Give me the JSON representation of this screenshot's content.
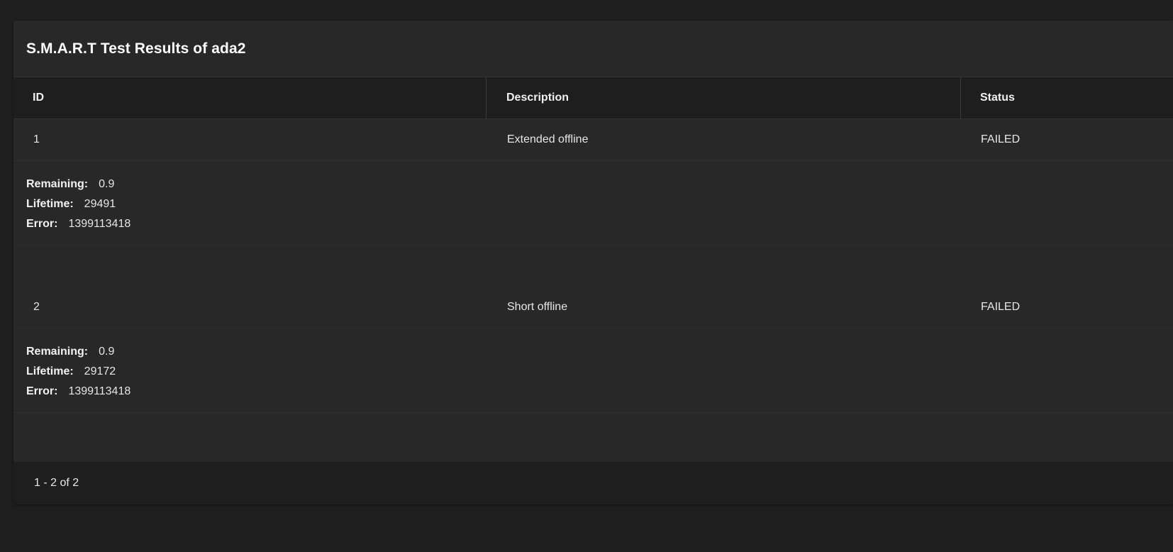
{
  "card": {
    "title": "S.M.A.R.T Test Results of ada2"
  },
  "table": {
    "columns": [
      "ID",
      "Description",
      "Status"
    ],
    "rows": [
      {
        "id": "1",
        "description": "Extended offline",
        "status": "FAILED",
        "details": {
          "remaining_label": "Remaining:",
          "remaining": "0.9",
          "lifetime_label": "Lifetime:",
          "lifetime": "29491",
          "error_label": "Error:",
          "error": "1399113418"
        }
      },
      {
        "id": "2",
        "description": "Short offline",
        "status": "FAILED",
        "details": {
          "remaining_label": "Remaining:",
          "remaining": "0.9",
          "lifetime_label": "Lifetime:",
          "lifetime": "29172",
          "error_label": "Error:",
          "error": "1399113418"
        }
      }
    ]
  },
  "pagination": {
    "range_text": "1 - 2 of 2"
  }
}
